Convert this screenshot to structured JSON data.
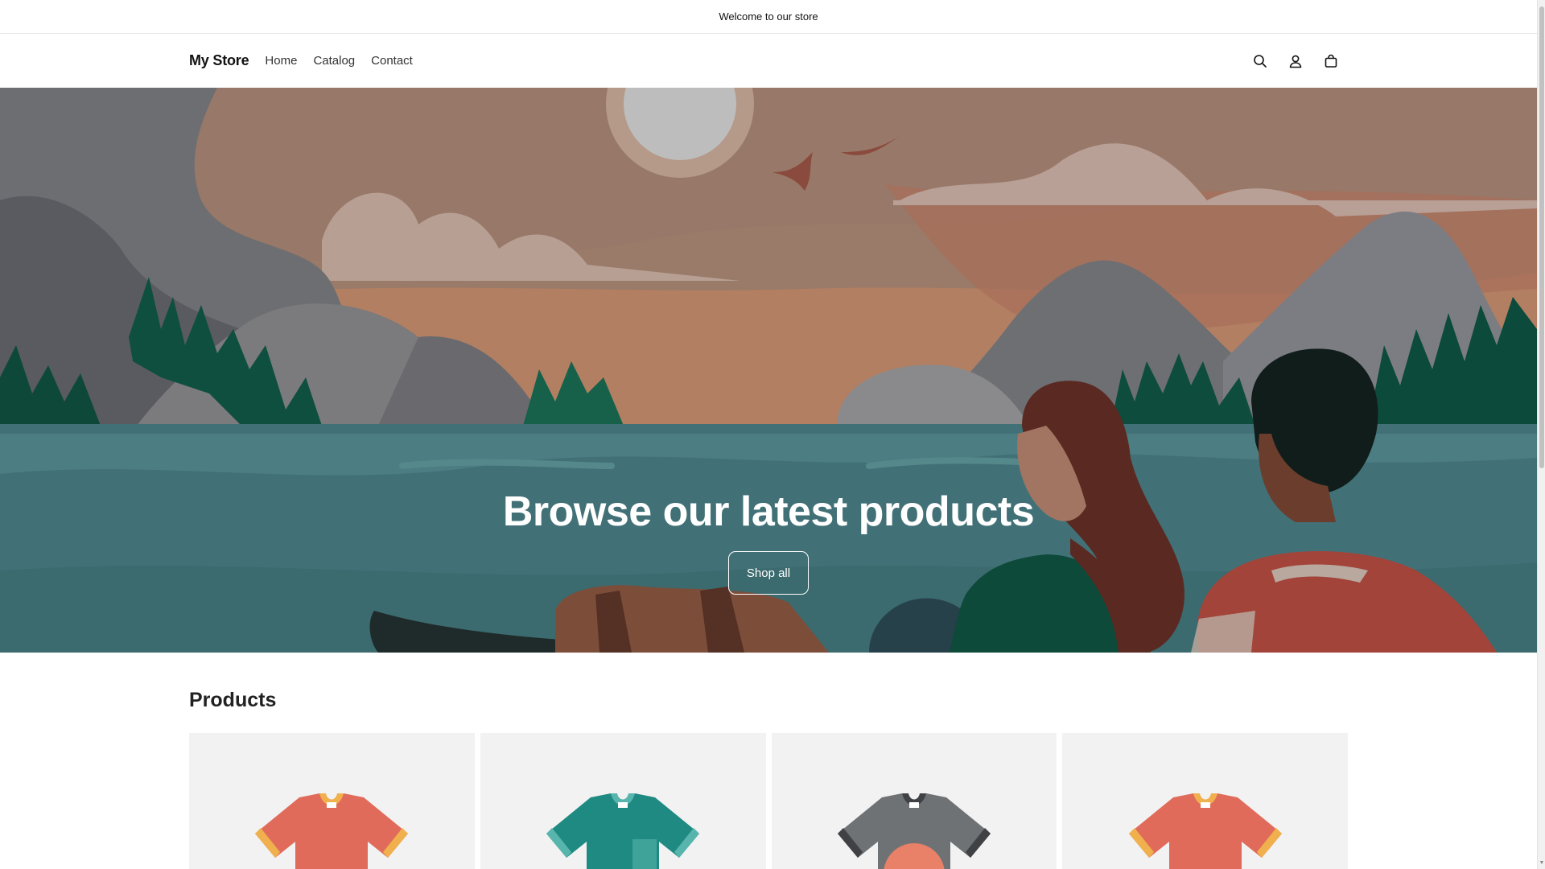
{
  "announcement": {
    "text": "Welcome to our store"
  },
  "header": {
    "logo": "My Store",
    "nav": [
      {
        "label": "Home"
      },
      {
        "label": "Catalog"
      },
      {
        "label": "Contact"
      }
    ],
    "icons": [
      "search-icon",
      "account-icon",
      "cart-icon"
    ]
  },
  "hero": {
    "title": "Browse our latest products",
    "button_label": "Shop all"
  },
  "products": {
    "title": "Products",
    "items": [
      {
        "image": "tshirt-red-icon",
        "color": "#e06b5a"
      },
      {
        "image": "tshirt-teal-icon",
        "color": "#1e8a82"
      },
      {
        "image": "tshirt-gray-icon",
        "color": "#6f7275"
      },
      {
        "image": "tshirt-red-icon",
        "color": "#e06b5a"
      }
    ]
  }
}
